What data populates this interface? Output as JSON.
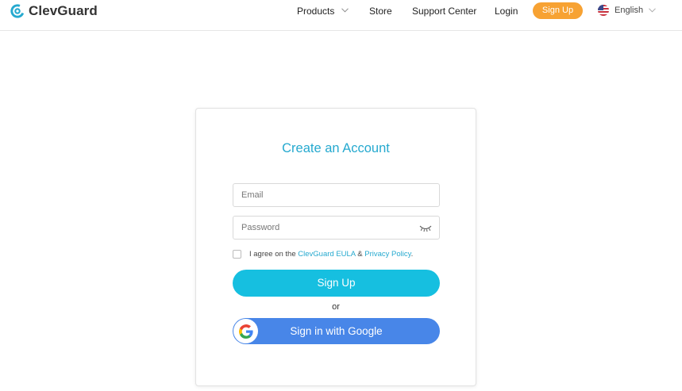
{
  "brand": {
    "name": "ClevGuard",
    "accent_color": "#25a9cf"
  },
  "nav": {
    "products": "Products",
    "store": "Store",
    "support": "Support Center",
    "login": "Login",
    "signup": "Sign Up",
    "signup_color": "#f7a233",
    "language": "English"
  },
  "form": {
    "title": "Create an Account",
    "email_placeholder": "Email",
    "password_placeholder": "Password",
    "agree_prefix": "I agree on the",
    "eula_link": "ClevGuard EULA",
    "ampersand": "&",
    "privacy_link": "Privacy Policy",
    "period": ".",
    "signup_button": "Sign Up",
    "signup_button_color": "#16bfe0",
    "or": "or",
    "google_button": "Sign in with Google",
    "google_button_color": "#4886e8"
  }
}
